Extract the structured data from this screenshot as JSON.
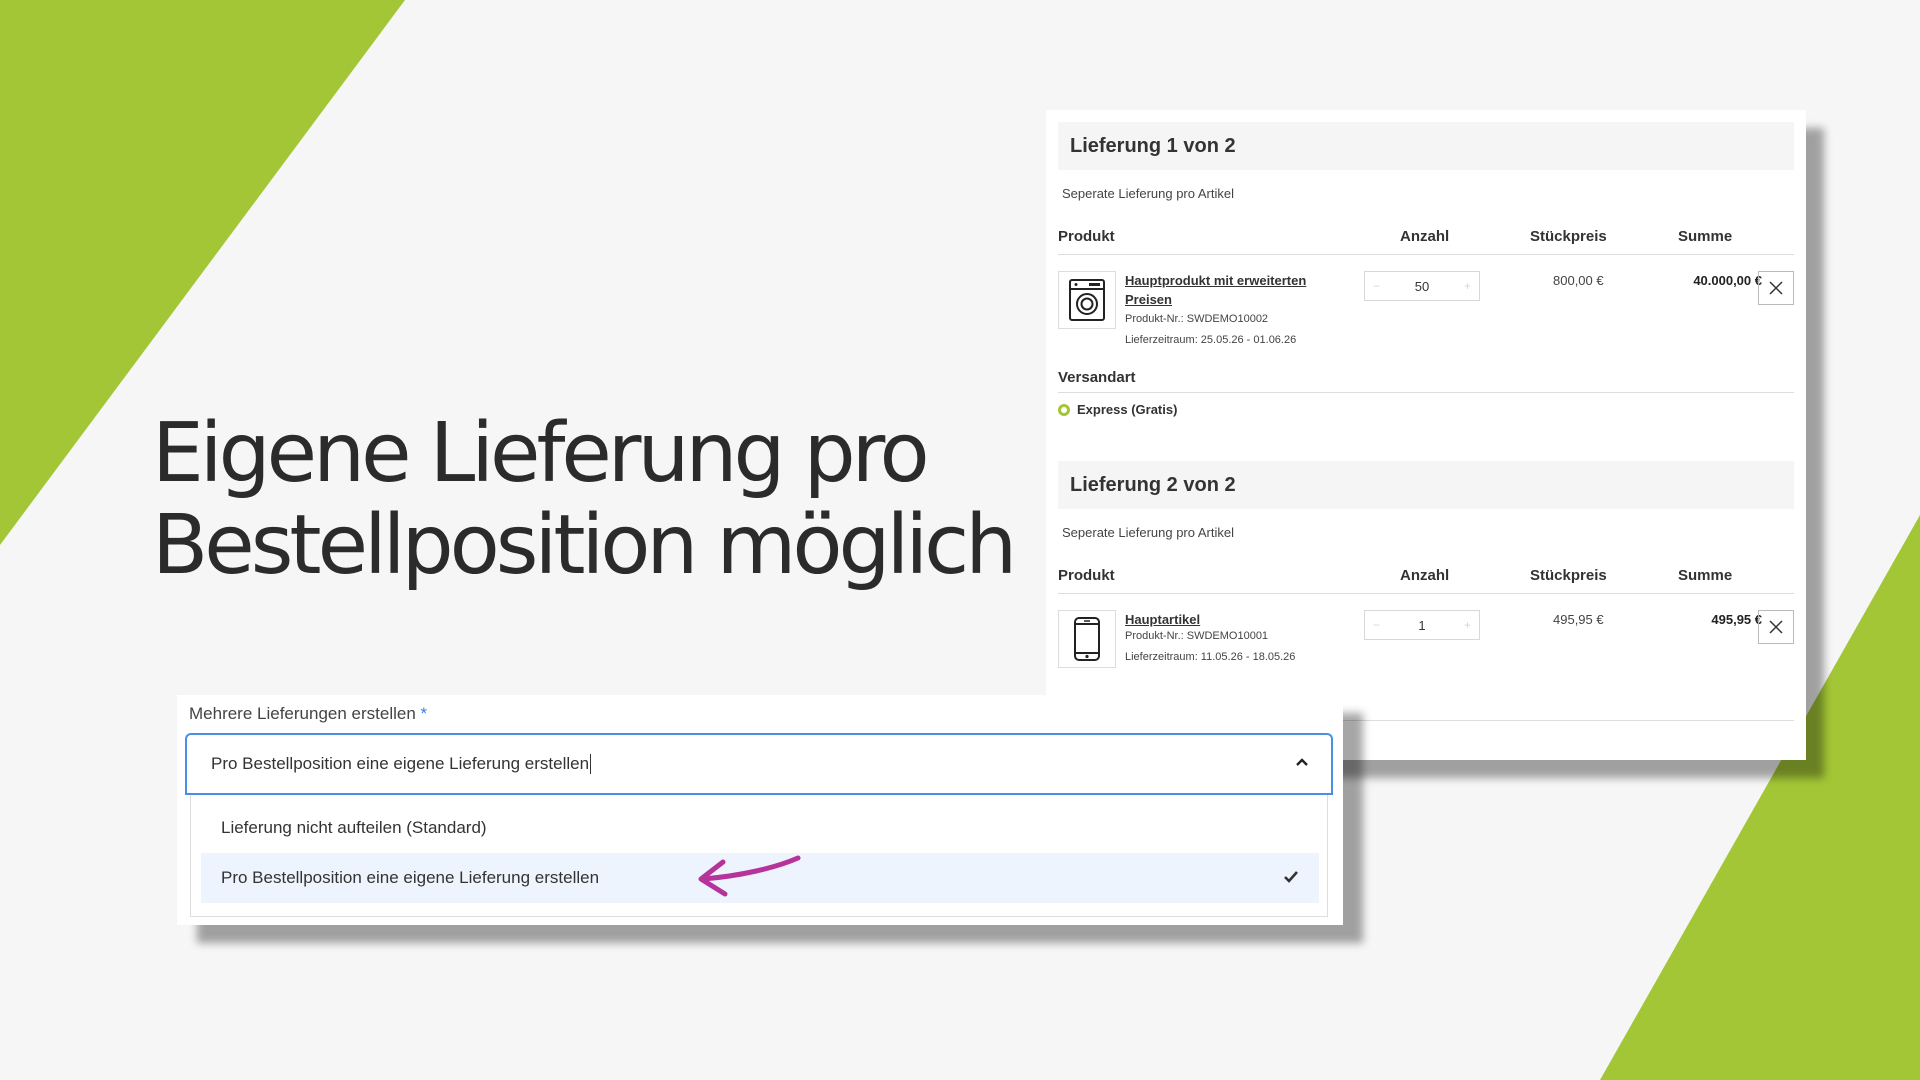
{
  "hero": {
    "line1": "Eigene Lieferung pro",
    "line2": "Bestellposition möglich"
  },
  "colors": {
    "accent_green": "#a3c636",
    "arrow": "#b5339a",
    "focus_blue": "#4a90e2"
  },
  "cart": {
    "columns": {
      "product": "Produkt",
      "quantity": "Anzahl",
      "unit_price": "Stückpreis",
      "total": "Summe"
    },
    "deliveries": [
      {
        "title": "Lieferung 1 von 2",
        "subtitle": "Seperate Lieferung pro Artikel",
        "item": {
          "icon": "washing-machine-icon",
          "name_line1": "Hauptprodukt mit erweiterten",
          "name_line2": "Preisen",
          "number": "Produkt-Nr.: SWDEMO10002",
          "period": "Lieferzeitraum: 25.05.26 - 01.06.26",
          "quantity": "50",
          "unit_price": "800,00 €",
          "total": "40.000,00 €"
        },
        "shipping": {
          "label": "Versandart",
          "option": "Express (Gratis)"
        }
      },
      {
        "title": "Lieferung 2 von 2",
        "subtitle": "Seperate Lieferung pro Artikel",
        "item": {
          "icon": "smartphone-icon",
          "name_line1": "Hauptartikel",
          "number": "Produkt-Nr.: SWDEMO10001",
          "period": "Lieferzeitraum: 11.05.26 - 18.05.26",
          "quantity": "1",
          "unit_price": "495,95 €",
          "total": "495,95 €"
        }
      }
    ]
  },
  "dropdown": {
    "label": "Mehrere Lieferungen erstellen",
    "required_mark": "*",
    "selected_value": "Pro Bestellposition eine eigene Lieferung erstellen",
    "options": [
      {
        "label": "Lieferung nicht aufteilen (Standard)",
        "selected": false
      },
      {
        "label": "Pro Bestellposition eine eigene Lieferung erstellen",
        "selected": true
      }
    ]
  }
}
